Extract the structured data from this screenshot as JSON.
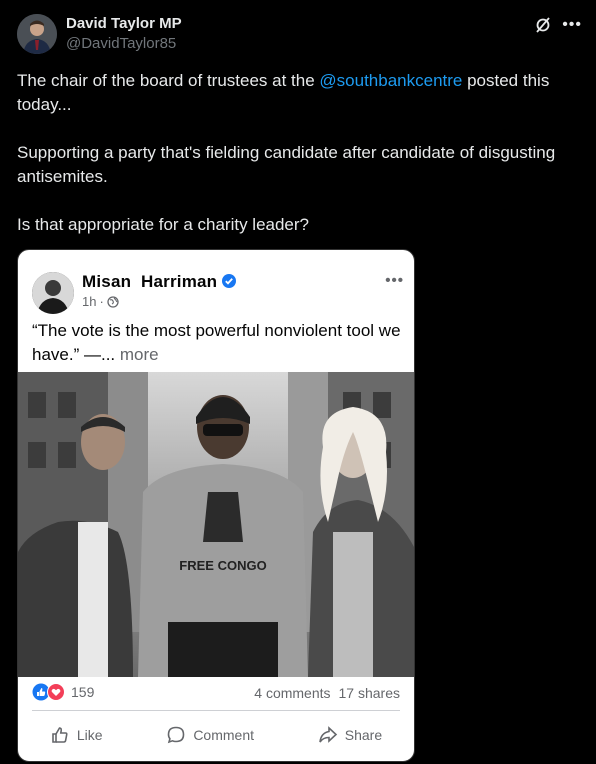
{
  "tweet": {
    "author_name": "David Taylor MP",
    "author_handle": "@DavidTaylor85",
    "text_part1_pre": "The chair of the board of trustees at the ",
    "mention": "@southbankcentre",
    "text_part1_post": " posted this today...",
    "text_part2": "Supporting a party that's fielding candidate after candidate of disgusting antisemites.",
    "text_part3": "Is that appropriate for a charity leader?",
    "more_icon": "more-dots-icon",
    "grok_icon": "grok-icon"
  },
  "fb_post": {
    "author_name": "Misan  Harriman",
    "time": "1h",
    "separator": "·",
    "audience_icon": "globe-icon",
    "text": "“The vote is the most powerful nonviolent tool we have.” —...",
    "see_more": "more",
    "photo_sweatshirt_text": "FREE CONGO",
    "reaction_count": "159",
    "comments": "4 comments",
    "shares": "17 shares",
    "actions": {
      "like": "Like",
      "comment": "Comment",
      "share": "Share"
    }
  },
  "colors": {
    "background": "#000000",
    "link": "#1d9bf0",
    "fb_blue": "#1877f2",
    "love_red": "#f33e58"
  }
}
